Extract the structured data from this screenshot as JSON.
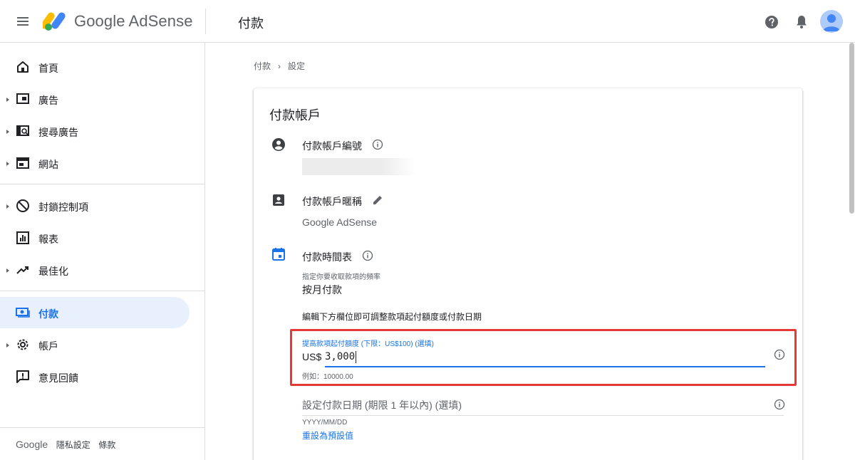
{
  "app": {
    "product_name": "Google AdSense",
    "page_title": "付款"
  },
  "sidebar": {
    "items": [
      {
        "label": "首頁"
      },
      {
        "label": "廣告"
      },
      {
        "label": "搜尋廣告"
      },
      {
        "label": "網站"
      },
      {
        "label": "封鎖控制項"
      },
      {
        "label": "報表"
      },
      {
        "label": "最佳化"
      },
      {
        "label": "付款"
      },
      {
        "label": "帳戶"
      },
      {
        "label": "意見回饋"
      }
    ],
    "footer": {
      "brand": "Google",
      "privacy": "隱私設定",
      "terms": "條款"
    }
  },
  "breadcrumb": {
    "parent": "付款",
    "separator": "›",
    "current": "設定"
  },
  "card": {
    "title": "付款帳戶",
    "account_id": {
      "label": "付款帳戶編號"
    },
    "nickname": {
      "label": "付款帳戶暱稱",
      "value": "Google AdSense"
    },
    "schedule": {
      "label": "付款時間表",
      "sub_label": "指定你要收取款項的頻率",
      "value": "按月付款"
    },
    "helper_text": "編輯下方欄位即可調整款項起付額度或付款日期",
    "threshold_field": {
      "label": "提高款項起付額度 (下限：US$100) (選填)",
      "prefix": "US$",
      "value": "3,000",
      "hint": "例如：10000.00"
    },
    "date_field": {
      "placeholder": "設定付款日期 (期限 1 年以內) (選填)",
      "hint": "YYYY/MM/DD",
      "reset_link": "重設為預設值"
    }
  },
  "colors": {
    "accent": "#1a73e8",
    "highlight": "#e53935",
    "active_nav_bg": "#e8f0fe",
    "divider": "#dadce0"
  },
  "icons": {
    "menu": "menu-icon",
    "help": "help-icon",
    "notifications": "bell-icon",
    "avatar": "avatar-icon"
  }
}
